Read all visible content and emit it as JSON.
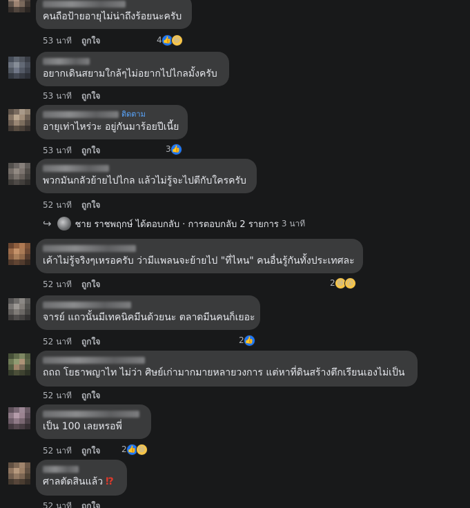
{
  "comments": [
    {
      "text": "คนถือป้ายอายุไม่น่าถึงร้อยนะครับ",
      "time": "53 นาที",
      "like_label": "ถูกใจ",
      "reaction_count": "4"
    },
    {
      "text": "อยากเดินสยามใกล้ๆไม่อยากไปไกลมั้งครับ",
      "time": "53 นาที",
      "like_label": "ถูกใจ"
    },
    {
      "text": "อายุเท่าไหร่วะ อยู่กันมาร้อยปีเนี้ย",
      "time": "53 นาที",
      "like_label": "ถูกใจ",
      "reaction_count": "3",
      "follow_label": "ติดตาม"
    },
    {
      "text": "พวกมันกลัวย้ายไปไกล แล้วไม่รู้จะไปตีกับใครครับ",
      "time": "52 นาที",
      "like_label": "ถูกใจ"
    },
    {
      "text": "เค้าไม่รู้จริงๆเหรอครับ ว่ามีแพลนจะย้ายไป \"ที่ไหน\" คนอื่นรู้กันทั้งประเทศละ",
      "time": "52 นาที",
      "like_label": "ถูกใจ",
      "reaction_count": "2"
    },
    {
      "text": "จารย์ แถวนั้นมีเทคนิคมีนด้วยนะ ตลาดมีนคนก็เยอะ",
      "time": "52 นาที",
      "like_label": "ถูกใจ",
      "reaction_count": "2"
    },
    {
      "text": "ถถถ โยธาพญาไท ไม่ว่า ศิษย์เก่ามากมายหลายวงการ แต่หาที่ดินสร้างตึกเรียนเองไม่เป็น",
      "time": "52 นาที",
      "like_label": "ถูกใจ"
    },
    {
      "text": "เป็น 100 เลยหรอพี่",
      "time": "52 นาที",
      "like_label": "ถูกใจ",
      "reaction_count": "2"
    },
    {
      "text": "ศาลตัดสินแล้ว",
      "emoji": "⁉",
      "time": "52 นาที",
      "like_label": "ถูกใจ"
    }
  ],
  "replies_row": {
    "arrow": "↪",
    "text": "ชาย ราชพฤกษ์ ได้ตอบกลับ · การตอบกลับ 2 รายการ",
    "time": "3 นาที"
  },
  "colors": {
    "background": "#18191a",
    "bubble": "#3a3b3c",
    "text": "#e4e6eb",
    "meta": "#b0b3b8",
    "like_blue": "#2078f4",
    "follow_blue": "#5aa7ff"
  },
  "icons": {
    "like": "like-reaction-icon",
    "haha": "haha-reaction-icon",
    "wow": "wow-reaction-icon",
    "reply_arrow": "reply-arrow-icon"
  }
}
